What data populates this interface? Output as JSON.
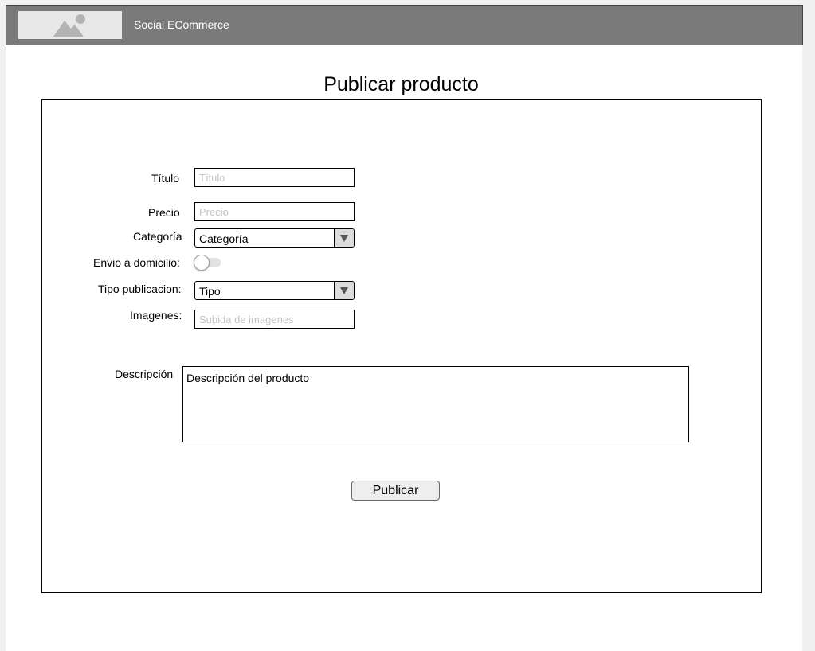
{
  "header": {
    "logo_icon": "image-placeholder-icon",
    "app_title": "Social ECommerce",
    "bg_color": "#7a7a7a"
  },
  "page": {
    "title": "Publicar producto"
  },
  "form": {
    "titulo": {
      "label": "Título",
      "placeholder": "Título",
      "value": ""
    },
    "precio": {
      "label": "Precio",
      "placeholder": "Precio",
      "value": ""
    },
    "categoria": {
      "label": "Categoría",
      "selected": "Categoría",
      "icon": "dropdown-arrow-icon"
    },
    "envio": {
      "label": "Envio a domicilio:",
      "state": "off"
    },
    "tipo": {
      "label": "Tipo publicacion:",
      "selected": "Tipo",
      "icon": "dropdown-arrow-icon"
    },
    "imagenes": {
      "label": "Imagenes:",
      "placeholder": "Subida de imagenes",
      "value": ""
    },
    "descripcion": {
      "label": "Descripción",
      "value": "Descripción del producto"
    },
    "submit_label": "Publicar"
  }
}
